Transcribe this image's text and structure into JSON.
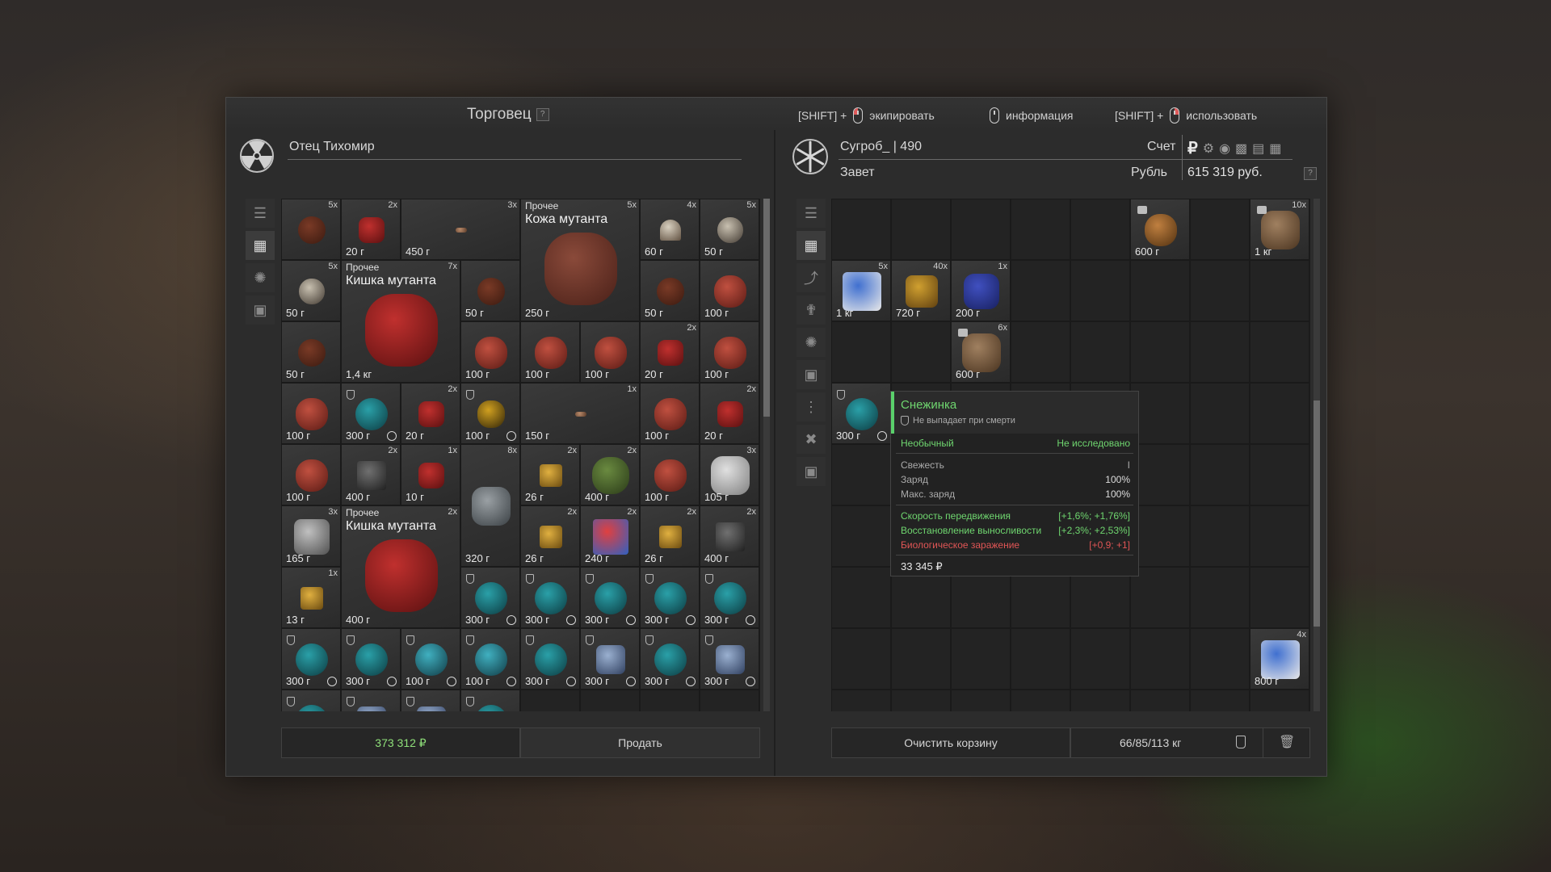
{
  "window": {
    "trader_title": "Торговец",
    "help_mark": "?",
    "hints": [
      {
        "prefix": "[SHIFT] +",
        "action": "экипировать"
      },
      {
        "prefix": "",
        "action": "информация"
      },
      {
        "prefix": "[SHIFT] +",
        "action": "использовать"
      }
    ]
  },
  "trader": {
    "name": "Отец Тихомир",
    "total": "373 312 ₽",
    "sell_label": "Продать"
  },
  "player": {
    "name": "Сугроб_ | 490",
    "faction": "Завет",
    "account_label": "Счет",
    "currency_label": "Рубль",
    "balance": "615 319 руб.",
    "currency_symbol": "₽",
    "clear_label": "Очистить корзину",
    "weight": "66/85/113 кг"
  },
  "trader_items": [
    {
      "c": 0,
      "r": 0,
      "w": 1,
      "h": 1,
      "count": "5x",
      "price": "",
      "kind": "fur"
    },
    {
      "c": 1,
      "r": 0,
      "w": 1,
      "h": 1,
      "count": "2x",
      "price": "20 г",
      "kind": "spike"
    },
    {
      "c": 2,
      "r": 0,
      "w": 2,
      "h": 1,
      "count": "3x",
      "price": "450 г",
      "kind": "bone"
    },
    {
      "c": 4,
      "r": 0,
      "w": 2,
      "h": 2,
      "count": "5x",
      "price": "250 г",
      "cat": "Прочее",
      "name": "Кожа мутанта",
      "kind": "skin"
    },
    {
      "c": 6,
      "r": 0,
      "w": 1,
      "h": 1,
      "count": "4x",
      "price": "60 г",
      "kind": "horn"
    },
    {
      "c": 7,
      "r": 0,
      "w": 1,
      "h": 1,
      "count": "5x",
      "price": "50 г",
      "kind": "claw"
    },
    {
      "c": 0,
      "r": 1,
      "w": 1,
      "h": 1,
      "count": "5x",
      "price": "50 г",
      "kind": "claw"
    },
    {
      "c": 1,
      "r": 1,
      "w": 2,
      "h": 2,
      "count": "7x",
      "price": "1,4 кг",
      "cat": "Прочее",
      "name": "Кишка мутанта",
      "kind": "gut"
    },
    {
      "c": 3,
      "r": 1,
      "w": 1,
      "h": 1,
      "count": "",
      "price": "50 г",
      "kind": "fur"
    },
    {
      "c": 6,
      "r": 1,
      "w": 1,
      "h": 1,
      "count": "",
      "price": "50 г",
      "kind": "fur"
    },
    {
      "c": 7,
      "r": 1,
      "w": 1,
      "h": 1,
      "count": "",
      "price": "100 г",
      "kind": "heart"
    },
    {
      "c": 0,
      "r": 2,
      "w": 1,
      "h": 1,
      "count": "",
      "price": "50 г",
      "kind": "fur"
    },
    {
      "c": 3,
      "r": 2,
      "w": 1,
      "h": 1,
      "count": "",
      "price": "100 г",
      "kind": "heart"
    },
    {
      "c": 4,
      "r": 2,
      "w": 1,
      "h": 1,
      "count": "",
      "price": "100 г",
      "kind": "heart"
    },
    {
      "c": 5,
      "r": 2,
      "w": 1,
      "h": 1,
      "count": "",
      "price": "100 г",
      "kind": "heart"
    },
    {
      "c": 6,
      "r": 2,
      "w": 1,
      "h": 1,
      "count": "2x",
      "price": "20 г",
      "kind": "spike"
    },
    {
      "c": 7,
      "r": 2,
      "w": 1,
      "h": 1,
      "count": "",
      "price": "100 г",
      "kind": "heart"
    },
    {
      "c": 0,
      "r": 3,
      "w": 1,
      "h": 1,
      "count": "",
      "price": "100 г",
      "kind": "heart"
    },
    {
      "c": 1,
      "r": 3,
      "w": 1,
      "h": 1,
      "count": "",
      "price": "300 г",
      "kind": "art",
      "shield": true,
      "clock": true
    },
    {
      "c": 2,
      "r": 3,
      "w": 1,
      "h": 1,
      "count": "2x",
      "price": "20 г",
      "kind": "spike"
    },
    {
      "c": 3,
      "r": 3,
      "w": 1,
      "h": 1,
      "count": "",
      "price": "100 г",
      "kind": "pod",
      "shield": true,
      "clock": true
    },
    {
      "c": 4,
      "r": 3,
      "w": 2,
      "h": 1,
      "count": "1x",
      "price": "150 г",
      "kind": "bone"
    },
    {
      "c": 6,
      "r": 3,
      "w": 1,
      "h": 1,
      "count": "",
      "price": "100 г",
      "kind": "heart"
    },
    {
      "c": 7,
      "r": 3,
      "w": 1,
      "h": 1,
      "count": "2x",
      "price": "20 г",
      "kind": "spike"
    },
    {
      "c": 0,
      "r": 4,
      "w": 1,
      "h": 1,
      "count": "",
      "price": "100 г",
      "kind": "heart"
    },
    {
      "c": 1,
      "r": 4,
      "w": 1,
      "h": 1,
      "count": "2x",
      "price": "400 г",
      "kind": "knife"
    },
    {
      "c": 2,
      "r": 4,
      "w": 1,
      "h": 1,
      "count": "1x",
      "price": "10 г",
      "kind": "spike"
    },
    {
      "c": 3,
      "r": 4,
      "w": 1,
      "h": 2,
      "count": "8x",
      "price": "320 г",
      "kind": "bottle"
    },
    {
      "c": 4,
      "r": 4,
      "w": 1,
      "h": 1,
      "count": "2x",
      "price": "26 г",
      "kind": "lighter"
    },
    {
      "c": 5,
      "r": 4,
      "w": 1,
      "h": 1,
      "count": "2x",
      "price": "400 г",
      "kind": "can"
    },
    {
      "c": 6,
      "r": 4,
      "w": 1,
      "h": 1,
      "count": "",
      "price": "100 г",
      "kind": "heart"
    },
    {
      "c": 7,
      "r": 4,
      "w": 1,
      "h": 1,
      "count": "3x",
      "price": "105 г",
      "kind": "roll"
    },
    {
      "c": 0,
      "r": 5,
      "w": 1,
      "h": 1,
      "count": "3x",
      "price": "165 г",
      "kind": "canister"
    },
    {
      "c": 1,
      "r": 5,
      "w": 2,
      "h": 2,
      "count": "2x",
      "price": "400 г",
      "cat": "Прочее",
      "name": "Кишка мутанта",
      "kind": "gut"
    },
    {
      "c": 4,
      "r": 5,
      "w": 1,
      "h": 1,
      "count": "2x",
      "price": "26 г",
      "kind": "lighter"
    },
    {
      "c": 5,
      "r": 5,
      "w": 1,
      "h": 1,
      "count": "2x",
      "price": "240 г",
      "kind": "cube"
    },
    {
      "c": 6,
      "r": 5,
      "w": 1,
      "h": 1,
      "count": "2x",
      "price": "26 г",
      "kind": "lighter"
    },
    {
      "c": 7,
      "r": 5,
      "w": 1,
      "h": 1,
      "count": "2x",
      "price": "400 г",
      "kind": "knife"
    },
    {
      "c": 0,
      "r": 6,
      "w": 1,
      "h": 1,
      "count": "1x",
      "price": "13 г",
      "kind": "lighter"
    },
    {
      "c": 3,
      "r": 6,
      "w": 1,
      "h": 1,
      "count": "",
      "price": "300 г",
      "kind": "art",
      "shield": true,
      "clock": true
    },
    {
      "c": 4,
      "r": 6,
      "w": 1,
      "h": 1,
      "count": "",
      "price": "300 г",
      "kind": "art",
      "shield": true,
      "clock": true
    },
    {
      "c": 5,
      "r": 6,
      "w": 1,
      "h": 1,
      "count": "",
      "price": "300 г",
      "kind": "art",
      "shield": true,
      "clock": true
    },
    {
      "c": 6,
      "r": 6,
      "w": 1,
      "h": 1,
      "count": "",
      "price": "300 г",
      "kind": "art",
      "shield": true,
      "clock": true
    },
    {
      "c": 7,
      "r": 6,
      "w": 1,
      "h": 1,
      "count": "",
      "price": "300 г",
      "kind": "art",
      "shield": true,
      "clock": true
    },
    {
      "c": 0,
      "r": 7,
      "w": 1,
      "h": 1,
      "count": "",
      "price": "300 г",
      "kind": "art",
      "shield": true,
      "clock": true
    },
    {
      "c": 1,
      "r": 7,
      "w": 1,
      "h": 1,
      "count": "",
      "price": "300 г",
      "kind": "art",
      "shield": true,
      "clock": true
    },
    {
      "c": 2,
      "r": 7,
      "w": 1,
      "h": 1,
      "count": "",
      "price": "100 г",
      "kind": "ring",
      "shield": true,
      "clock": true
    },
    {
      "c": 3,
      "r": 7,
      "w": 1,
      "h": 1,
      "count": "",
      "price": "100 г",
      "kind": "ring",
      "shield": true,
      "clock": true
    },
    {
      "c": 4,
      "r": 7,
      "w": 1,
      "h": 1,
      "count": "",
      "price": "300 г",
      "kind": "art",
      "shield": true,
      "clock": true
    },
    {
      "c": 5,
      "r": 7,
      "w": 1,
      "h": 1,
      "count": "",
      "price": "300 г",
      "kind": "crystal",
      "shield": true,
      "clock": true
    },
    {
      "c": 6,
      "r": 7,
      "w": 1,
      "h": 1,
      "count": "",
      "price": "300 г",
      "kind": "art",
      "shield": true,
      "clock": true
    },
    {
      "c": 7,
      "r": 7,
      "w": 1,
      "h": 1,
      "count": "",
      "price": "300 г",
      "kind": "crystal",
      "shield": true,
      "clock": true
    },
    {
      "c": 0,
      "r": 8,
      "w": 1,
      "h": 1,
      "count": "",
      "price": "",
      "kind": "art",
      "shield": true
    },
    {
      "c": 1,
      "r": 8,
      "w": 1,
      "h": 1,
      "count": "",
      "price": "",
      "kind": "crystal",
      "shield": true
    },
    {
      "c": 2,
      "r": 8,
      "w": 1,
      "h": 1,
      "count": "",
      "price": "",
      "kind": "crystal",
      "shield": true
    },
    {
      "c": 3,
      "r": 8,
      "w": 1,
      "h": 1,
      "count": "",
      "price": "",
      "kind": "art",
      "shield": true
    }
  ],
  "player_items": [
    {
      "c": 5,
      "r": 0,
      "w": 1,
      "h": 1,
      "count": "",
      "price": "600 г",
      "kind": "grenade",
      "lock": true
    },
    {
      "c": 7,
      "r": 0,
      "w": 1,
      "h": 1,
      "count": "10x",
      "price": "1 кг",
      "kind": "bread",
      "lock": true
    },
    {
      "c": 0,
      "r": 1,
      "w": 1,
      "h": 1,
      "count": "5x",
      "price": "1 кг",
      "kind": "medkit"
    },
    {
      "c": 1,
      "r": 1,
      "w": 1,
      "h": 1,
      "count": "40x",
      "price": "720 г",
      "kind": "ammo"
    },
    {
      "c": 2,
      "r": 1,
      "w": 1,
      "h": 1,
      "count": "1x",
      "price": "200 г",
      "kind": "battery"
    },
    {
      "c": 2,
      "r": 2,
      "w": 1,
      "h": 1,
      "count": "6x",
      "price": "600 г",
      "kind": "bread",
      "lock": true
    },
    {
      "c": 0,
      "r": 3,
      "w": 1,
      "h": 1,
      "count": "",
      "price": "300 г",
      "kind": "art",
      "shield": true,
      "clock": true
    },
    {
      "c": 7,
      "r": 7,
      "w": 1,
      "h": 1,
      "count": "4x",
      "price": "800 г",
      "kind": "medkit"
    }
  ],
  "tooltip": {
    "name": "Снежинка",
    "death_note": "Не выпадает при смерти",
    "rarity": "Необычный",
    "research": "Не исследовано",
    "stats": [
      {
        "label": "Свежесть",
        "value": "I"
      },
      {
        "label": "Заряд",
        "value": "100%"
      },
      {
        "label": "Макс. заряд",
        "value": "100%"
      }
    ],
    "effects": [
      {
        "label": "Скорость передвижения",
        "value": "[+1,6%; +1,76%]",
        "tone": "green"
      },
      {
        "label": "Восстановление выносливости",
        "value": "[+2,3%; +2,53%]",
        "tone": "green"
      },
      {
        "label": "Биологическое заражение",
        "value": "[+0,9; +1]",
        "tone": "red"
      }
    ],
    "price": "33 345 ₽"
  },
  "colors": {
    "accent_green": "#5ad06b",
    "negative_red": "#e05555",
    "panel_bg": "#2c2c2c"
  }
}
